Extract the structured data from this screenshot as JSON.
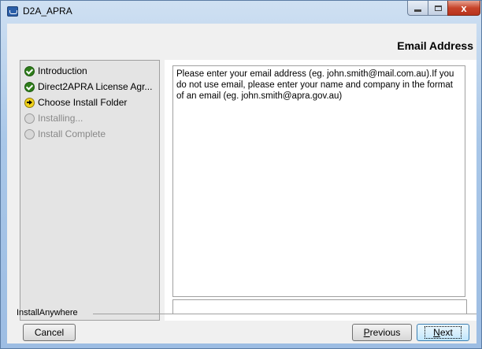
{
  "window": {
    "title": "D2A_APRA",
    "close_glyph": "x"
  },
  "header": {
    "title": "Email Address"
  },
  "steps": [
    {
      "label": "Introduction",
      "status": "done"
    },
    {
      "label": "Direct2APRA License Agr...",
      "status": "done"
    },
    {
      "label": "Choose Install Folder",
      "status": "current"
    },
    {
      "label": "Installing...",
      "status": "pending"
    },
    {
      "label": "Install Complete",
      "status": "pending"
    }
  ],
  "main": {
    "description": "Please enter your email address (eg. john.smith@mail.com.au).If you do not use email, please enter your name and company in the format of an email (eg. john.smith@apra.gov.au)",
    "email_value": ""
  },
  "footer": {
    "brand": "InstallAnywhere",
    "cancel_label": "Cancel",
    "previous_mnemonic": "P",
    "previous_rest": "revious",
    "next_mnemonic": "N",
    "next_rest": "ext"
  },
  "colors": {
    "step_done": "#2e7d1a",
    "step_current": "#f2d21a",
    "step_pending": "#d8d8d8",
    "close_button": "#c7442b"
  }
}
